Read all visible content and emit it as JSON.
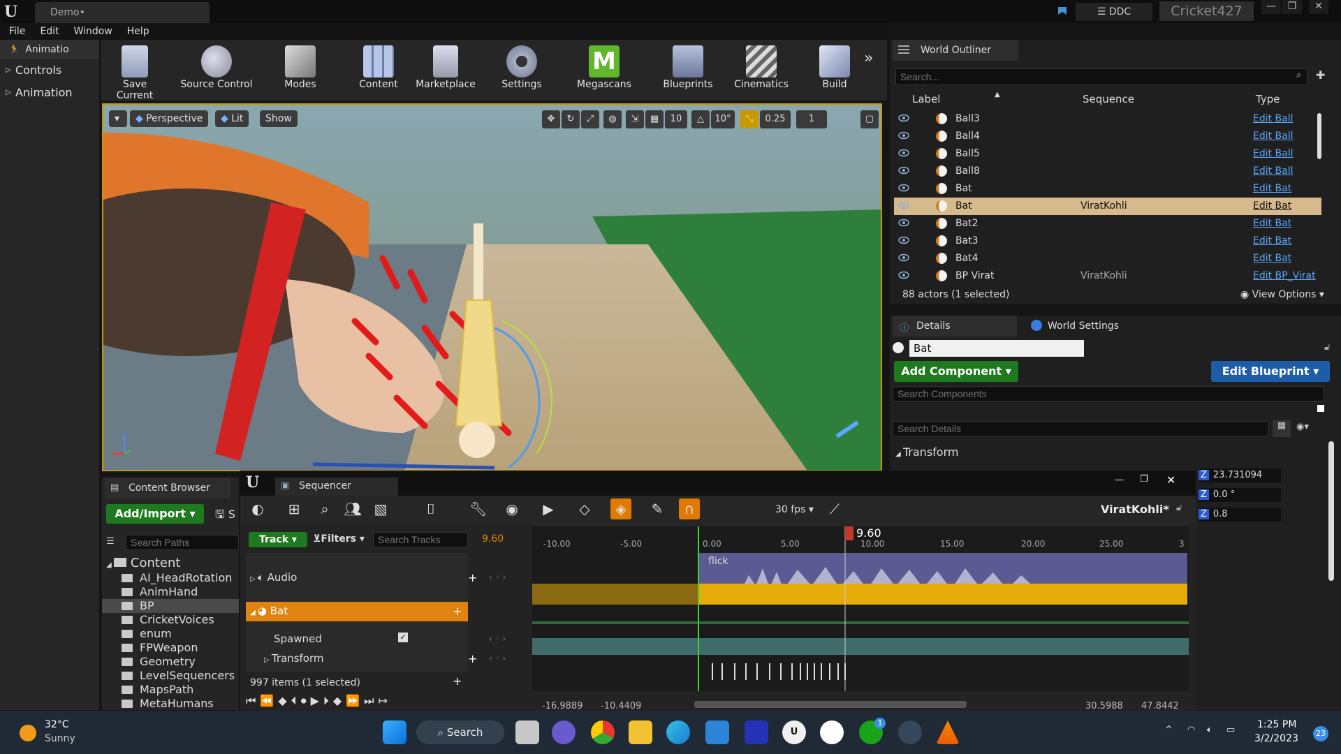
{
  "window": {
    "tab_title": "Demo•",
    "ddc_label": "DDC",
    "user": "Cricket427"
  },
  "menu": [
    "File",
    "Edit",
    "Window",
    "Help"
  ],
  "left_panel": {
    "title": "Animatio",
    "items": [
      "Controls",
      "Animation"
    ]
  },
  "toolbar": {
    "buttons": [
      "Save Current",
      "Source Control",
      "Modes",
      "Content",
      "Marketplace",
      "Settings",
      "Megascans",
      "Blueprints",
      "Cinematics",
      "Build"
    ]
  },
  "viewport": {
    "perspective": "Perspective",
    "lit": "Lit",
    "show": "Show",
    "grid_value": "10",
    "angle_value": "10°",
    "scale_value": "0.25",
    "camera_speed": "1"
  },
  "outliner": {
    "tab": "World Outliner",
    "search_placeholder": "Search...",
    "columns": [
      "Label",
      "Sequence",
      "Type"
    ],
    "rows": [
      {
        "label": "Ball3",
        "sequence": "",
        "type": "Edit Ball"
      },
      {
        "label": "Ball4",
        "sequence": "",
        "type": "Edit Ball"
      },
      {
        "label": "Ball5",
        "sequence": "",
        "type": "Edit Ball"
      },
      {
        "label": "Ball8",
        "sequence": "",
        "type": "Edit Ball"
      },
      {
        "label": "Bat",
        "sequence": "",
        "type": "Edit Bat"
      },
      {
        "label": "Bat",
        "sequence": "ViratKohli",
        "type": "Edit Bat"
      },
      {
        "label": "Bat2",
        "sequence": "",
        "type": "Edit Bat"
      },
      {
        "label": "Bat3",
        "sequence": "",
        "type": "Edit Bat"
      },
      {
        "label": "Bat4",
        "sequence": "",
        "type": "Edit Bat"
      },
      {
        "label": "BP Virat",
        "sequence": "ViratKohli",
        "type": "Edit BP_Virat"
      }
    ],
    "status": "88 actors (1 selected)",
    "view_options": "View Options"
  },
  "details": {
    "tab": "Details",
    "world_settings_tab": "World Settings",
    "object_name": "Bat",
    "add_component": "Add Component",
    "edit_blueprint": "Edit Blueprint",
    "search_components": "Search Components",
    "search_details": "Search Details",
    "transform": "Transform",
    "values": [
      "23.731094",
      "0.0 °",
      "0.8"
    ],
    "axis": "Z"
  },
  "content_browser": {
    "tab": "Content Browser",
    "add_import": "Add/Import",
    "save": "S",
    "search_paths": "Search Paths",
    "root": "Content",
    "folders": [
      "AI_HeadRotation",
      "AnimHand",
      "BP",
      "CricketVoices",
      "enum",
      "FPWeapon",
      "Geometry",
      "LevelSequencers",
      "MapsPath",
      "MetaHumans"
    ]
  },
  "sequencer": {
    "tab": "Sequencer",
    "fps": "30 fps",
    "sequence_name": "ViratKohli*",
    "track_button": "Track",
    "filters_button": "Filters",
    "search_tracks": "Search Tracks",
    "current_time": "9.60",
    "playhead": "9.60",
    "ruler": [
      "-10.00",
      "-5.00",
      "0.00",
      "5.00",
      "10.00",
      "15.00",
      "20.00",
      "25.00",
      "3"
    ],
    "tracks": {
      "audio": "Audio",
      "bat": "Bat",
      "spawned": "Spawned",
      "transform": "Transform"
    },
    "clip_label": "flick",
    "items_status": "997 items (1 selected)",
    "range": [
      "-16.9889",
      "-10.4409",
      "30.5988",
      "47.8442"
    ]
  },
  "taskbar": {
    "temp": "32°C",
    "weather": "Sunny",
    "search": "Search",
    "time": "1:25 PM",
    "date": "3/2/2023",
    "badge": "23",
    "xbox_badge": "1"
  }
}
